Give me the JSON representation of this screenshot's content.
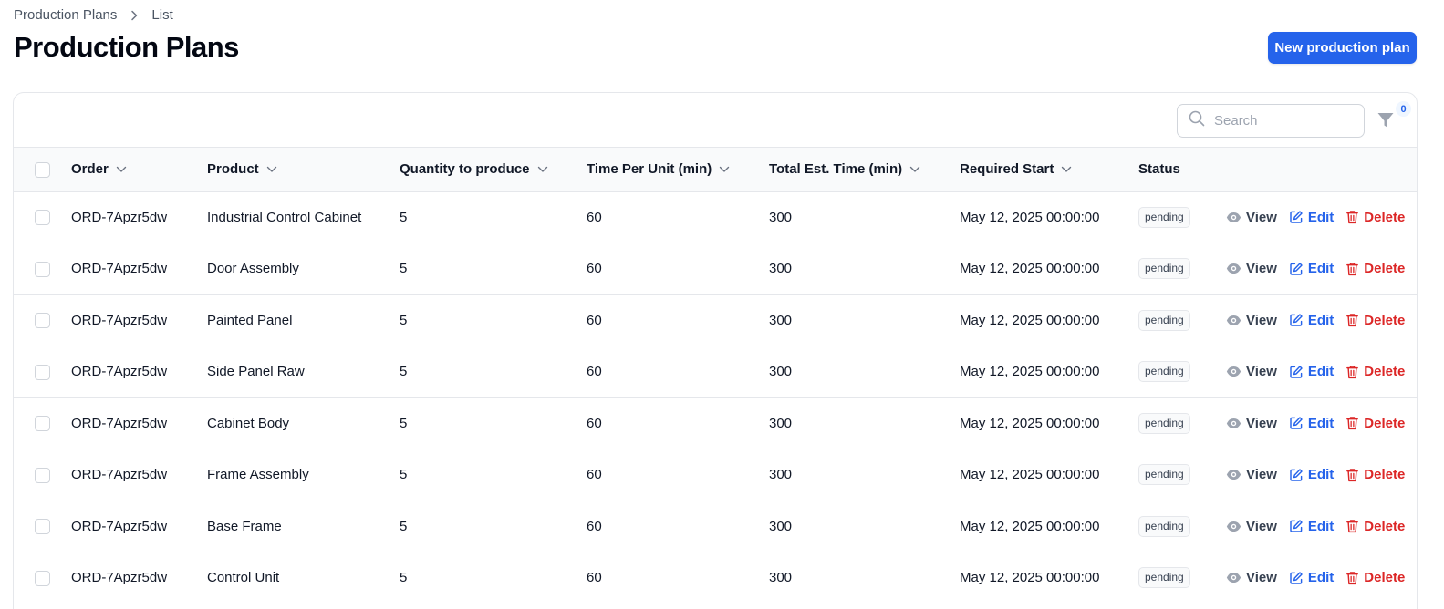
{
  "breadcrumb": {
    "parent": "Production Plans",
    "current": "List"
  },
  "page": {
    "title": "Production Plans"
  },
  "actions": {
    "new_label": "New production plan"
  },
  "toolbar": {
    "search_placeholder": "Search",
    "filter_count": "0"
  },
  "table": {
    "headers": {
      "order": "Order",
      "product": "Product",
      "quantity": "Quantity to produce",
      "time_per_unit": "Time Per Unit (min)",
      "total_time": "Total Est. Time (min)",
      "required_start": "Required Start",
      "status": "Status"
    },
    "row_actions": {
      "view": "View",
      "edit": "Edit",
      "delete": "Delete"
    },
    "rows": [
      {
        "order": "ORD-7Apzr5dw",
        "product": "Industrial Control Cabinet",
        "quantity": "5",
        "time_per_unit": "60",
        "total_time": "300",
        "required_start": "May 12, 2025 00:00:00",
        "status": "pending"
      },
      {
        "order": "ORD-7Apzr5dw",
        "product": "Door Assembly",
        "quantity": "5",
        "time_per_unit": "60",
        "total_time": "300",
        "required_start": "May 12, 2025 00:00:00",
        "status": "pending"
      },
      {
        "order": "ORD-7Apzr5dw",
        "product": "Painted Panel",
        "quantity": "5",
        "time_per_unit": "60",
        "total_time": "300",
        "required_start": "May 12, 2025 00:00:00",
        "status": "pending"
      },
      {
        "order": "ORD-7Apzr5dw",
        "product": "Side Panel Raw",
        "quantity": "5",
        "time_per_unit": "60",
        "total_time": "300",
        "required_start": "May 12, 2025 00:00:00",
        "status": "pending"
      },
      {
        "order": "ORD-7Apzr5dw",
        "product": "Cabinet Body",
        "quantity": "5",
        "time_per_unit": "60",
        "total_time": "300",
        "required_start": "May 12, 2025 00:00:00",
        "status": "pending"
      },
      {
        "order": "ORD-7Apzr5dw",
        "product": "Frame Assembly",
        "quantity": "5",
        "time_per_unit": "60",
        "total_time": "300",
        "required_start": "May 12, 2025 00:00:00",
        "status": "pending"
      },
      {
        "order": "ORD-7Apzr5dw",
        "product": "Base Frame",
        "quantity": "5",
        "time_per_unit": "60",
        "total_time": "300",
        "required_start": "May 12, 2025 00:00:00",
        "status": "pending"
      },
      {
        "order": "ORD-7Apzr5dw",
        "product": "Control Unit",
        "quantity": "5",
        "time_per_unit": "60",
        "total_time": "300",
        "required_start": "May 12, 2025 00:00:00",
        "status": "pending"
      }
    ]
  },
  "colors": {
    "primary": "#2563eb",
    "danger": "#dc2626",
    "muted": "#6b7280"
  }
}
